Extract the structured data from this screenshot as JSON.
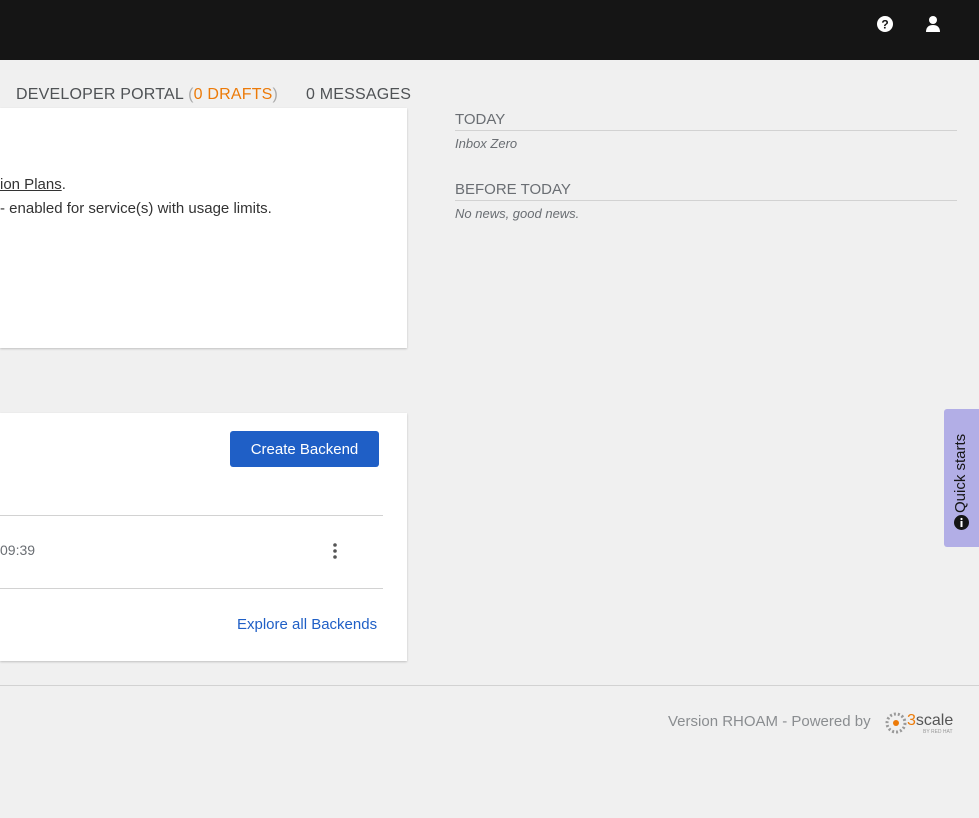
{
  "header": {
    "help_icon": "question-circle-icon",
    "user_icon": "user-icon"
  },
  "tabs": {
    "developer_portal": "DEVELOPER PORTAL",
    "drafts_open": "(",
    "drafts": "0 DRAFTS",
    "drafts_close": ")",
    "messages": "0 MESSAGES"
  },
  "card1": {
    "link_text": "ion Plans",
    "link_suffix": ".",
    "line2": "enabled for service(s) with usage limits."
  },
  "news": {
    "today": "TODAY",
    "today_sub": "Inbox Zero",
    "before": "BEFORE TODAY",
    "before_sub": "No news, good news."
  },
  "backends": {
    "create_button": "Create Backend",
    "row_time": "09:39",
    "explore_link": "Explore all Backends"
  },
  "quick_starts": "Quick starts",
  "footer": {
    "version": "Version RHOAM - Powered by",
    "logo_text": "3scale",
    "logo_sub": "BY RED HAT"
  },
  "colors": {
    "accent": "#ec7a08",
    "primary": "#1f5fc6",
    "link": "#0066cc"
  }
}
